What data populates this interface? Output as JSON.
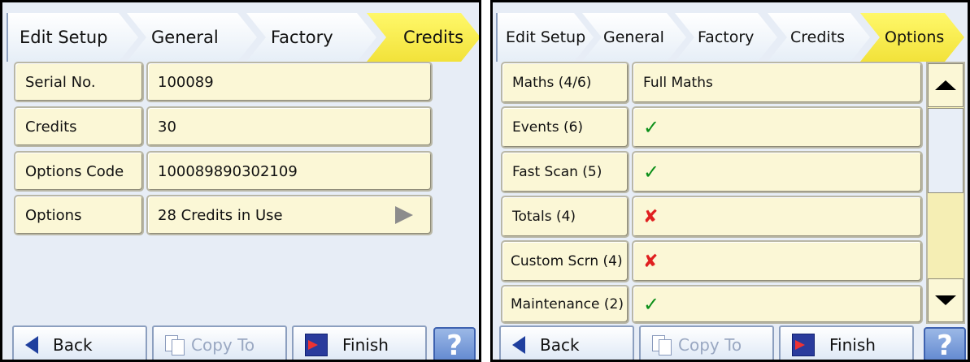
{
  "left": {
    "breadcrumb": [
      "Edit Setup",
      "General",
      "Factory",
      "Credits"
    ],
    "active_crumb": "Credits",
    "rows": [
      {
        "label": "Serial No.",
        "value": "100089"
      },
      {
        "label": "Credits",
        "value": "30"
      },
      {
        "label": "Options Code",
        "value": "100089890302109"
      },
      {
        "label": "Options",
        "value": "28 Credits in Use",
        "arrow": "right-arrow-icon"
      }
    ],
    "buttons": {
      "back": "Back",
      "copy": "Copy To",
      "finish": "Finish",
      "help": "?"
    }
  },
  "right": {
    "breadcrumb": [
      "Edit Setup",
      "General",
      "Factory",
      "Credits",
      "Options"
    ],
    "active_crumb": "Options",
    "rows": [
      {
        "label": "Maths (4/6)",
        "value": "Full Maths"
      },
      {
        "label": "Events (6)",
        "status": "✓"
      },
      {
        "label": "Fast Scan (5)",
        "status": "✓"
      },
      {
        "label": "Totals (4)",
        "status": "✘"
      },
      {
        "label": "Custom Scrn (4)",
        "status": "✘"
      },
      {
        "label": "Maintenance (2)",
        "status": "✓"
      }
    ],
    "buttons": {
      "back": "Back",
      "copy": "Copy To",
      "finish": "Finish",
      "help": "?"
    }
  },
  "colors": {
    "active_tab": "#f2e23a",
    "cell_bg": "#fbf7d6",
    "check": "#0b8f19",
    "cross": "#e02020",
    "panel_bg": "#e7edf6"
  }
}
